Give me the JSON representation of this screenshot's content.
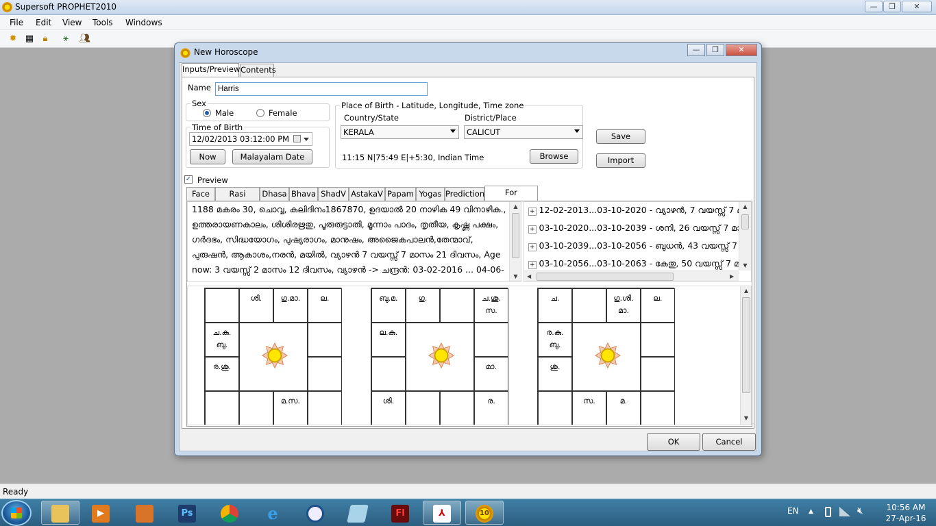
{
  "app": {
    "title": "Supersoft PROPHET2010"
  },
  "menu": [
    "File",
    "Edit",
    "View",
    "Tools",
    "Windows"
  ],
  "status": "Ready",
  "dialog": {
    "title": "New Horoscope",
    "tabs": [
      "Inputs/Preview",
      "Contents"
    ],
    "name_label": "Name",
    "name_value": "Harris",
    "sex": {
      "legend": "Sex",
      "male": "Male",
      "female": "Female",
      "selected": "Male"
    },
    "time_of_birth": {
      "legend": "Time of Birth",
      "value": "12/02/2013  03:12:00 PM",
      "now_button": "Now",
      "malayalam_button": "Malayalam Date"
    },
    "place": {
      "legend": "Place of Birth - Latitude, Longitude, Time zone",
      "country_label": "Country/State",
      "country_value": "KERALA",
      "district_label": "District/Place",
      "district_value": "CALICUT",
      "coords": "11:15 N|75:49 E|+5:30, Indian Time",
      "browse_button": "Browse"
    },
    "save_button": "Save",
    "import_button": "Import",
    "preview_label": "Preview",
    "preview_tabs": [
      "Face",
      "Rasi Charts",
      "Dhasa",
      "Bhava",
      "ShadV",
      "AstakaV",
      "Papam",
      "Yogas",
      "Prediction",
      "For Astrologer"
    ],
    "astrologer_text": [
      "1188 മകരം  30, ചൊവ്വ, കലിദിനം1867870, ഉദയാൽ 20 നാഴിക 49 വിനാഴിക.,",
      "ഉത്തരായണകാലം, ശിശിരഋതു, പൂരുരുട്ടാതി, മൂന്നാം പാദം, തൃതീയ, കൃഷ്ണ പക്ഷം,",
      "ഗർദഭം, സിദ്ധയോഗം, പുഷ്യരാഗം, മാനുഷം, അജൈകപാലൻ,തേന്മാവ്,",
      "പുരുഷൻ, ആകാശം,നരൻ, മയിൽ, വ്യാഴൻ 7 വയസ്സ് 7 മാസം 21 ദിവസം, Age",
      "now: 3 വയസ്സ് 2 മാസം 12 ദിവസം, വ്യാഴൻ -> ചന്ദ്രൻ: 03-02-2016 ... 04-06-"
    ],
    "dasa_tree": [
      "12-02-2013...03-10-2020 - വ്യാഴൻ, 7 വയസ്സ് 7 മ",
      "03-10-2020...03-10-2039 - ശനി, 26 വയസ്സ് 7 മാസ",
      "03-10-2039...03-10-2056 - ബുധൻ, 43 വയസ്സ് 7 മ",
      "03-10-2056...03-10-2063 - കേതു, 50 വയസ്സ് 7 മ"
    ],
    "charts": [
      {
        "cells": {
          "r0c0": "",
          "r0c1": "ശി.",
          "r0c2": "ഗു.മാ.",
          "r0c3": "ല.",
          "r1c0": "ച.കു.\nബു.",
          "r1c3": "",
          "r2c0": "ര.ശു.",
          "r2c3": "",
          "r3c0": "",
          "r3c1": "",
          "r3c2": "മ.സ.",
          "r3c3": ""
        }
      },
      {
        "cells": {
          "r0c0": "ബു.മ.",
          "r0c1": "ഗു.",
          "r0c2": "",
          "r0c3": "ച.ശു.\nസ.",
          "r1c0": "ല.കു.",
          "r1c3": "",
          "r2c0": "",
          "r2c3": "മാ.",
          "r3c0": "ശി.",
          "r3c1": "",
          "r3c2": "",
          "r3c3": "ര."
        }
      },
      {
        "cells": {
          "r0c0": "ച.",
          "r0c1": "",
          "r0c2": "ഗു.ശി.\nമാ.",
          "r0c3": "ല.",
          "r1c0": "ര.കു.\nബു.",
          "r1c3": "",
          "r2c0": "ശു.",
          "r2c3": "",
          "r3c0": "",
          "r3c1": "സ.",
          "r3c2": "മ.",
          "r3c3": ""
        }
      }
    ],
    "ok_button": "OK",
    "cancel_button": "Cancel"
  },
  "taskbar": {
    "apps": [
      "file-explorer",
      "media-player",
      "image-viewer",
      "photoshop",
      "chrome",
      "internet-explorer",
      "stopwatch",
      "notebook",
      "flash",
      "acrobat",
      "prophet"
    ],
    "lang": "EN",
    "time": "10:56 AM",
    "date": "27-Apr-16"
  }
}
